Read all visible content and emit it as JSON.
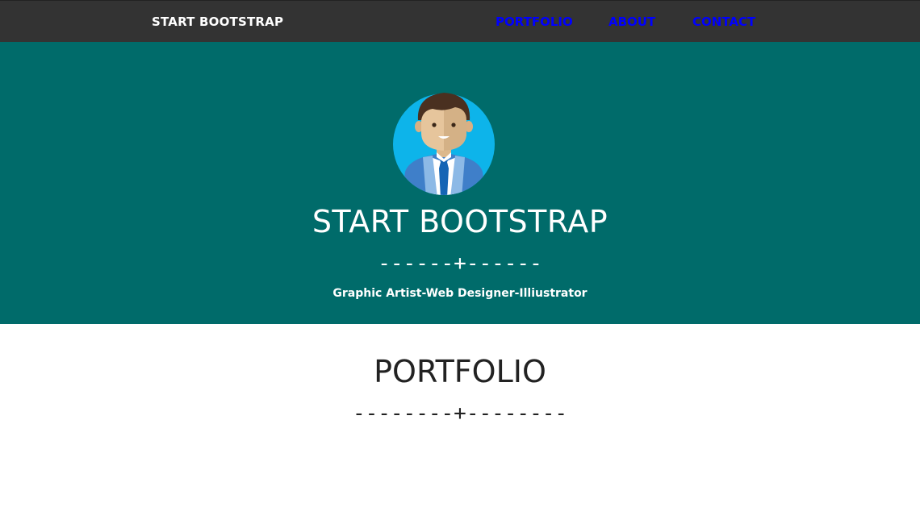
{
  "navbar": {
    "brand": "START BOOTSTRAP",
    "links": [
      "PORTFOLIO",
      "ABOUT",
      "CONTACT"
    ],
    "background": "#333333",
    "link_color": "#0000ff"
  },
  "hero": {
    "background": "#006b6a",
    "avatar_icon": "businessman-avatar-icon",
    "title": "START BOOTSTRAP",
    "divider": "------+------",
    "subtitle": "Graphic Artist-Web Designer-Illiustrator"
  },
  "portfolio": {
    "title": "PORTFOLIO",
    "divider": "--------+--------"
  }
}
